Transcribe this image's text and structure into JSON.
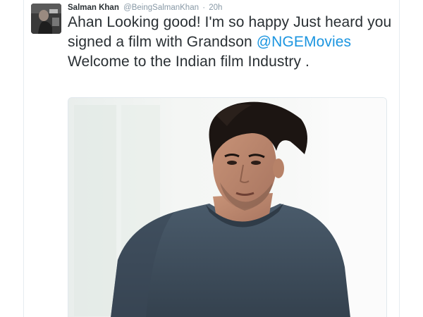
{
  "tweet": {
    "author_name": "Salman Khan",
    "handle": "@BeingSalmanKhan",
    "separator": "·",
    "timestamp": "20h",
    "text_before_mention": "Ahan Looking good! I'm so happy Just heard you signed a film with Grandson ",
    "mention": "@NGEMovies",
    "text_after_mention": " Welcome to the Indian film Industry ."
  },
  "colors": {
    "author_text": "#292f33",
    "meta_text": "#8899a6",
    "link": "#1b95e0",
    "shirt": "#3f4f5f",
    "background": "#ffffff"
  },
  "icons": {
    "avatar": "profile-photo",
    "media": "photo-of-young-man-in-grey-tshirt"
  }
}
